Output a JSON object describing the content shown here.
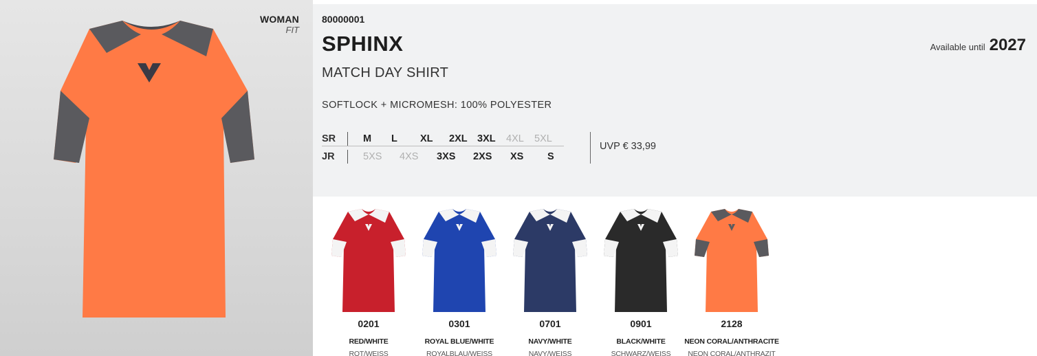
{
  "hero": {
    "fit_title": "WOMAN",
    "fit_sub": "FIT",
    "body_color": "#ff7a45",
    "accent_color": "#5a5a5e",
    "logo_color": "#3a3a44"
  },
  "product": {
    "code": "80000001",
    "name": "SPHINX",
    "subtitle": "MATCH DAY SHIRT",
    "material": "SOFTLOCK + MICROMESH: 100% POLYESTER",
    "available_label": "Available until",
    "available_year": "2027",
    "price": "UVP € 33,99"
  },
  "sizes": {
    "sr_label": "SR",
    "jr_label": "JR",
    "sr": [
      {
        "label": "M",
        "available": true
      },
      {
        "label": "L",
        "available": true
      },
      {
        "label": "XL",
        "available": true
      },
      {
        "label": "2XL",
        "available": true
      },
      {
        "label": "3XL",
        "available": true
      },
      {
        "label": "4XL",
        "available": false
      },
      {
        "label": "5XL",
        "available": false
      }
    ],
    "jr": [
      {
        "label": "5XS",
        "available": false
      },
      {
        "label": "4XS",
        "available": false
      },
      {
        "label": "3XS",
        "available": true
      },
      {
        "label": "2XS",
        "available": true
      },
      {
        "label": "XS",
        "available": true
      },
      {
        "label": "S",
        "available": true
      }
    ]
  },
  "variants": [
    {
      "code": "0201",
      "name": "RED/WHITE",
      "name_de": "ROT/WEISS",
      "body": "#c8202c",
      "accent": "#f4f4f4"
    },
    {
      "code": "0301",
      "name": "ROYAL BLUE/WHITE",
      "name_de": "ROYALBLAU/WEISS",
      "body": "#1f45b0",
      "accent": "#f4f4f4"
    },
    {
      "code": "0701",
      "name": "NAVY/WHITE",
      "name_de": "NAVY/WEISS",
      "body": "#2c3a66",
      "accent": "#f4f4f4"
    },
    {
      "code": "0901",
      "name": "BLACK/WHITE",
      "name_de": "SCHWARZ/WEISS",
      "body": "#2a2a2a",
      "accent": "#f4f4f4"
    },
    {
      "code": "2128",
      "name": "NEON CORAL/ANTHRACITE",
      "name_de": "NEON CORAL/ANTHRAZIT",
      "body": "#ff7a45",
      "accent": "#5a5a5e"
    }
  ]
}
